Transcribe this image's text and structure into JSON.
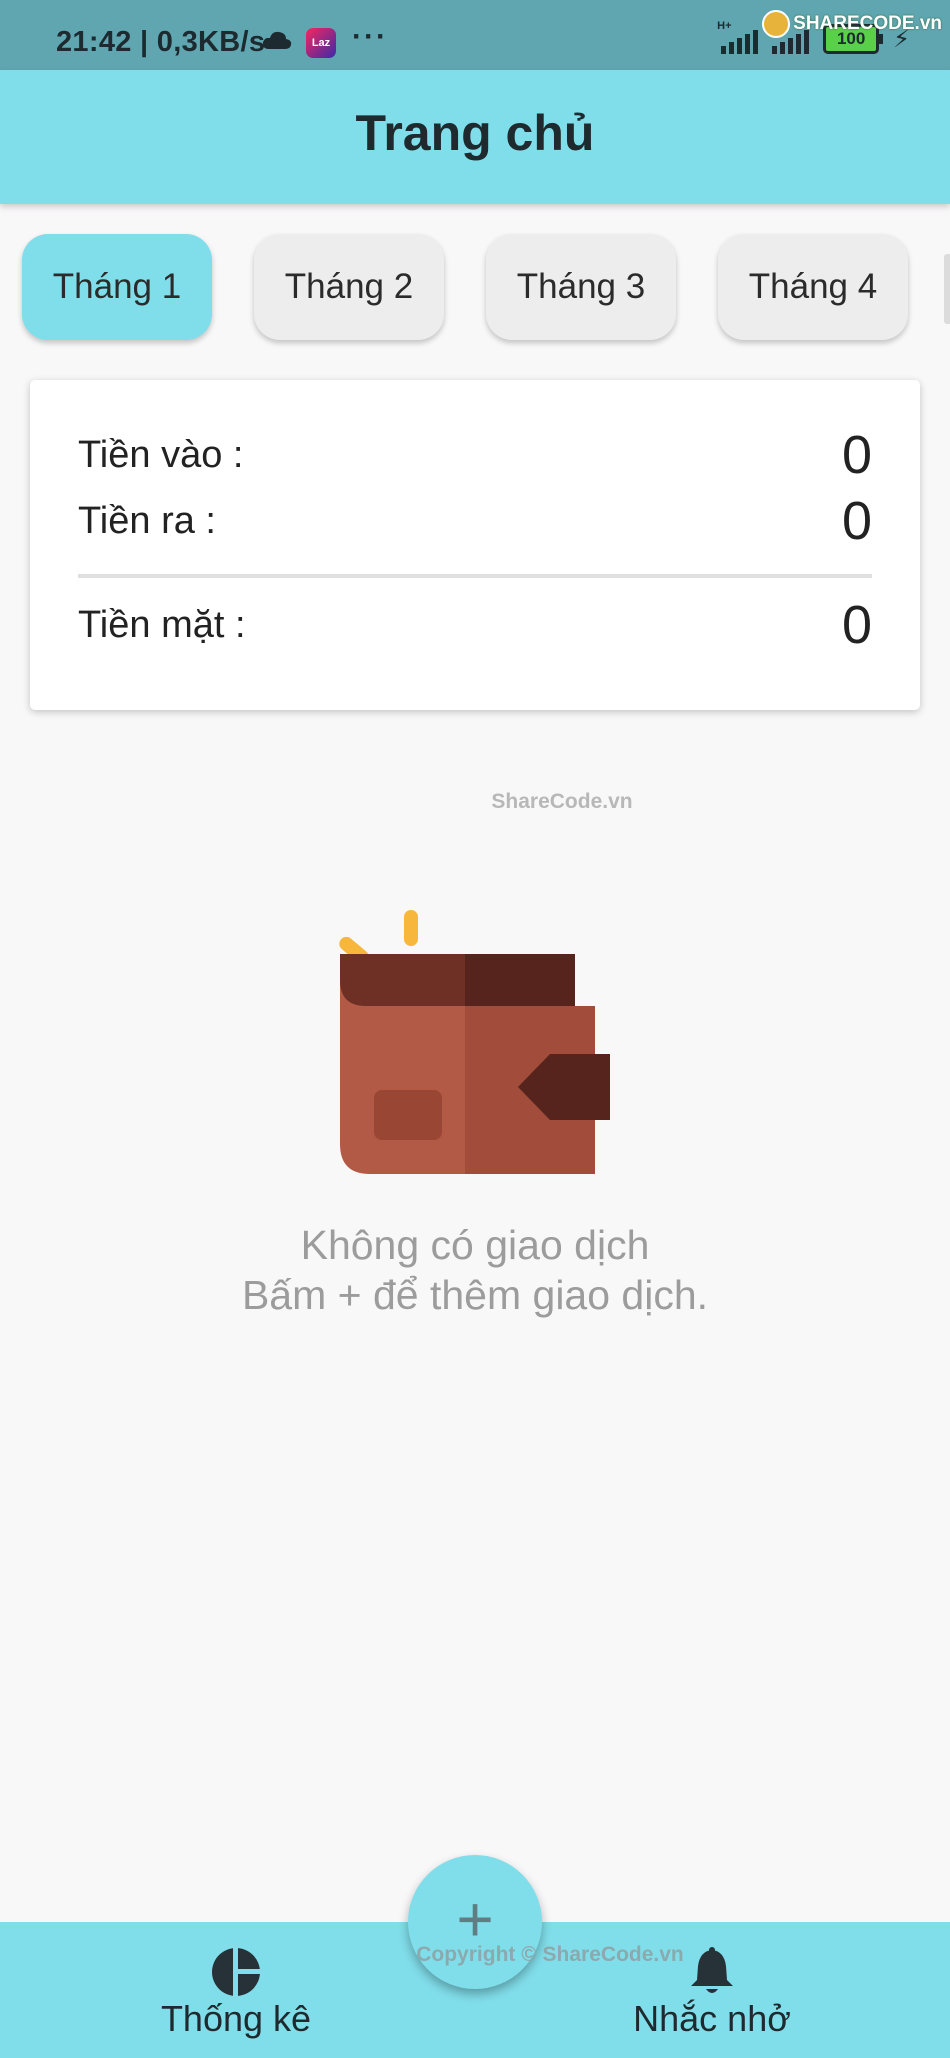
{
  "status_bar": {
    "time": "21:42 | 0,3KB/s",
    "dots": "···",
    "network": "H+",
    "battery": "100",
    "watermark": "SHARECODE.vn"
  },
  "header": {
    "title": "Trang chủ"
  },
  "months": [
    {
      "label": "Tháng 1",
      "selected": true
    },
    {
      "label": "Tháng 2",
      "selected": false
    },
    {
      "label": "Tháng 3",
      "selected": false
    },
    {
      "label": "Tháng 4",
      "selected": false
    }
  ],
  "summary": {
    "income_label": "Tiền vào :",
    "income_value": "0",
    "expense_label": "Tiền ra :",
    "expense_value": "0",
    "cash_label": "Tiền mặt :",
    "cash_value": "0"
  },
  "watermark_mid": "ShareCode.vn",
  "empty_state": {
    "line1": "Không có giao dịch",
    "line2": "Bấm + để thêm giao dịch."
  },
  "fab": {
    "label": "+"
  },
  "bottom_nav": {
    "stats_label": "Thống kê",
    "reminder_label": "Nhắc nhở"
  },
  "watermark_copyright": "Copyright © ShareCode.vn",
  "colors": {
    "accent": "#80deea",
    "chip_bg": "#eeeded",
    "status_bar": "#60a6b1"
  }
}
